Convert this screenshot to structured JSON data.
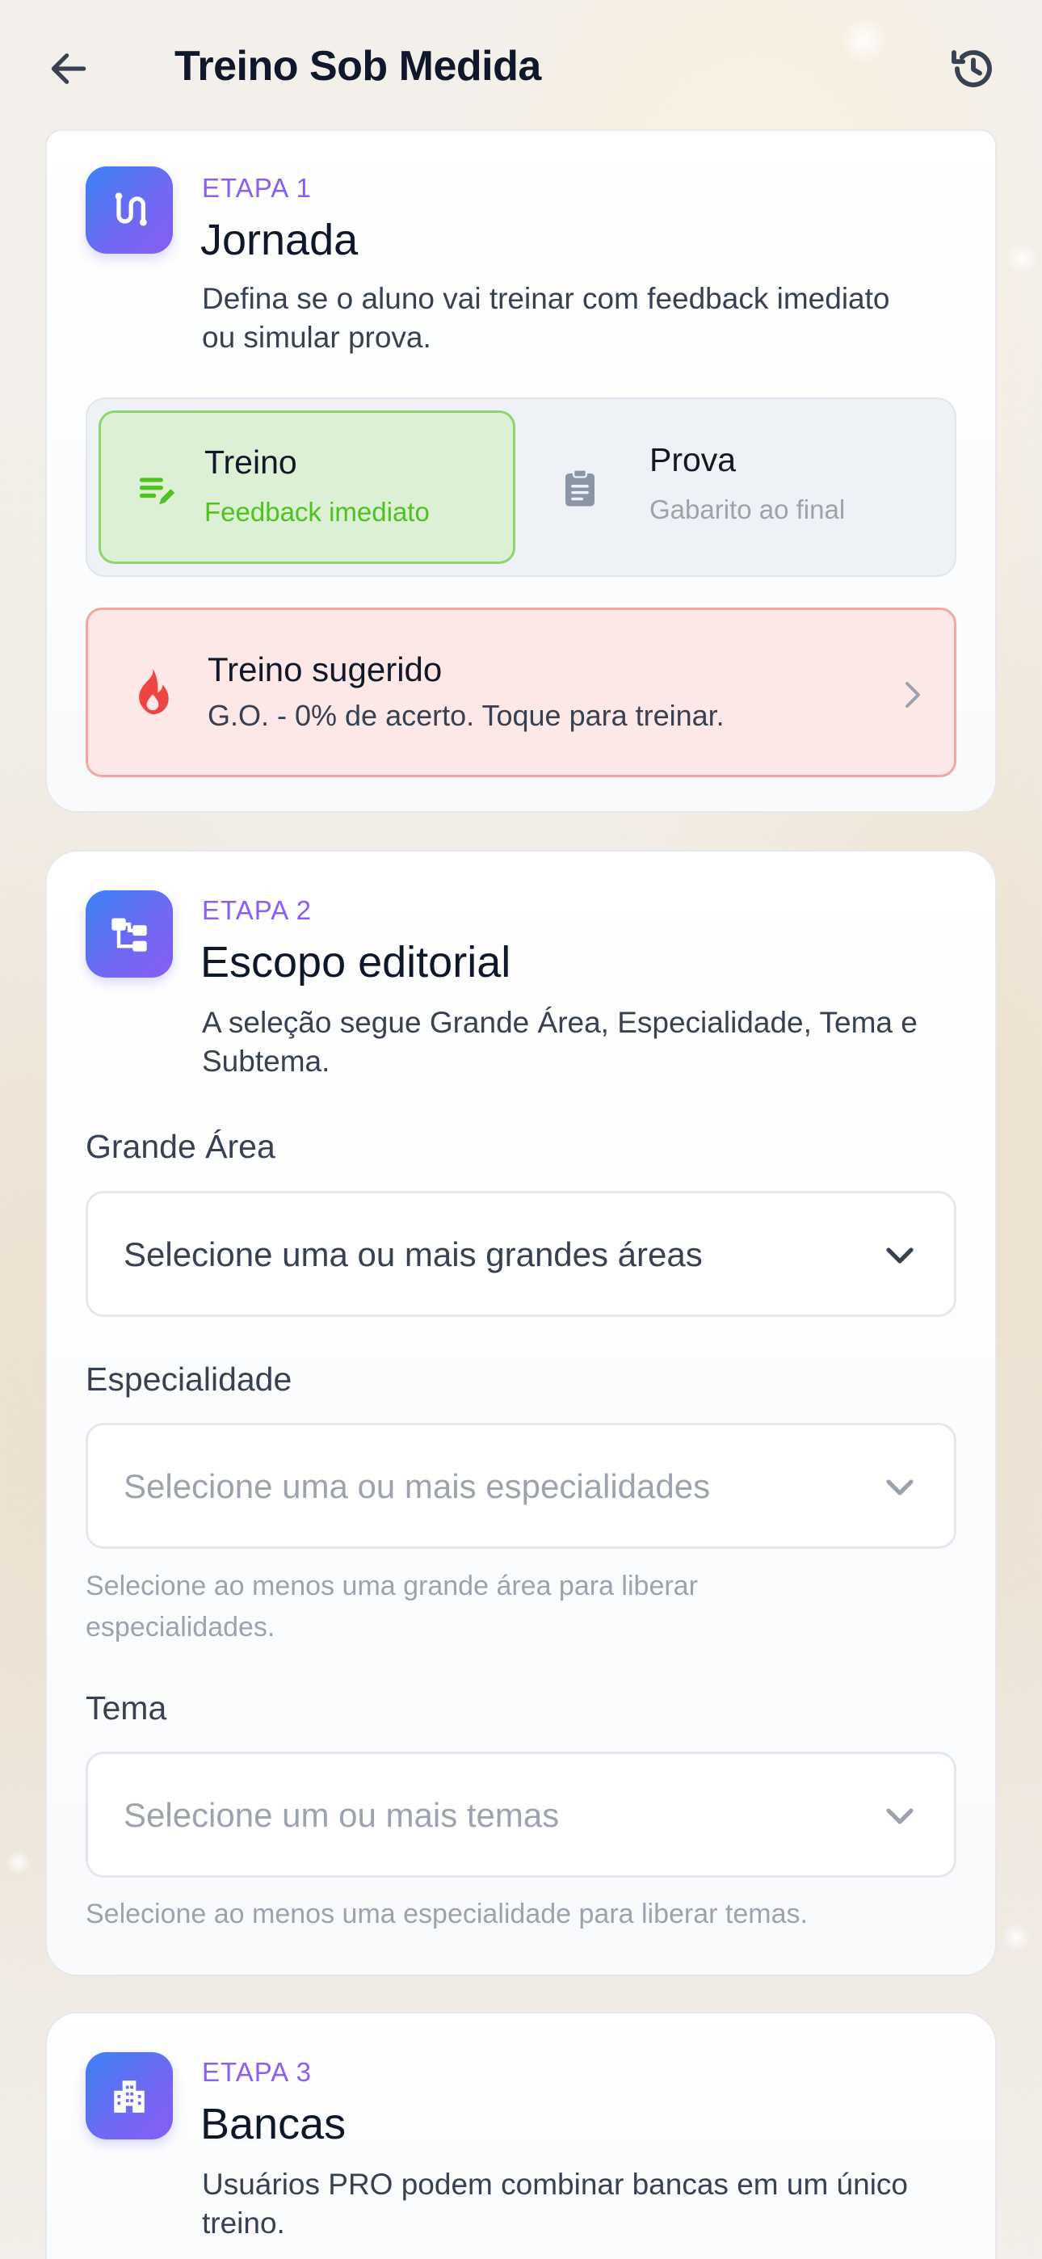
{
  "header": {
    "title": "Treino Sob Medida",
    "back_icon": "arrow-left-icon",
    "history_icon": "history-icon"
  },
  "colors": {
    "accent_purple": "#8b5cf6",
    "treino_green": "#4fc21f",
    "suggest_red": "#ef4444"
  },
  "step1": {
    "label": "ETAPA 1",
    "title": "Jornada",
    "description": "Defina se o aluno vai treinar com feedback imediato ou simular prova.",
    "icon": "route-icon",
    "modes": [
      {
        "title": "Treino",
        "subtitle": "Feedback imediato",
        "icon": "edit-list-icon",
        "selected": true
      },
      {
        "title": "Prova",
        "subtitle": "Gabarito ao final",
        "icon": "clipboard-icon",
        "selected": false
      }
    ],
    "suggested": {
      "title": "Treino sugerido",
      "subtitle": "G.O. - 0% de acerto. Toque para treinar.",
      "icon": "flame-icon"
    }
  },
  "step2": {
    "label": "ETAPA 2",
    "title": "Escopo editorial",
    "description": "A seleção segue Grande Área, Especialidade, Tema e Subtema.",
    "icon": "hierarchy-icon",
    "fields": [
      {
        "label": "Grande Área",
        "placeholder": "Selecione uma ou mais grandes áreas",
        "enabled": true,
        "hint": ""
      },
      {
        "label": "Especialidade",
        "placeholder": "Selecione uma ou mais especialidades",
        "enabled": false,
        "hint": "Selecione ao menos uma grande área para liberar especialidades."
      },
      {
        "label": "Tema",
        "placeholder": "Selecione um ou mais temas",
        "enabled": false,
        "hint": "Selecione ao menos uma especialidade para liberar temas."
      }
    ]
  },
  "step3": {
    "label": "ETAPA 3",
    "title": "Bancas",
    "description": "Usuários PRO podem combinar bancas em um único treino.",
    "icon": "building-icon"
  }
}
